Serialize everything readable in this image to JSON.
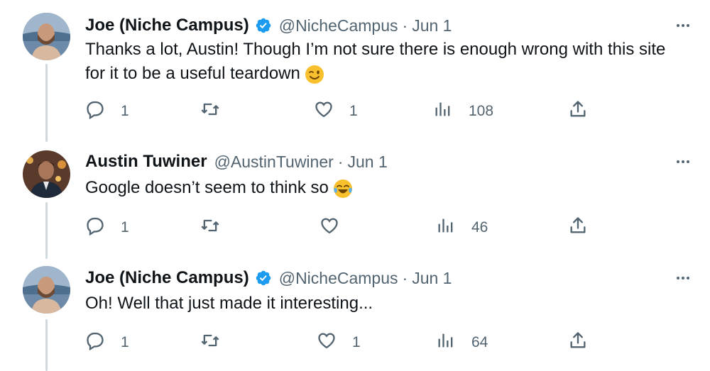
{
  "tweets": [
    {
      "name": "Joe (Niche Campus)",
      "verified": true,
      "handle": "@NicheCampus",
      "separator": "·",
      "date": "Jun 1",
      "text": "Thanks a lot, Austin! Though I’m not sure there is enough wrong with this site for it to be a useful teardown",
      "emoji": "winking-face",
      "replies": "1",
      "retweets": "",
      "likes": "1",
      "views": "108"
    },
    {
      "name": "Austin Tuwiner",
      "verified": false,
      "handle": "@AustinTuwiner",
      "separator": "·",
      "date": "Jun 1",
      "text": "Google doesn’t seem to think so",
      "emoji": "tears-of-joy",
      "replies": "1",
      "retweets": "",
      "likes": "",
      "views": "46"
    },
    {
      "name": "Joe (Niche Campus)",
      "verified": true,
      "handle": "@NicheCampus",
      "separator": "·",
      "date": "Jun 1",
      "text": "Oh! Well that just made it interesting...",
      "emoji": "",
      "replies": "1",
      "retweets": "",
      "likes": "1",
      "views": "64"
    }
  ],
  "colors": {
    "text": "#0f1419",
    "secondary": "#536471",
    "verified": "#1d9bf0",
    "thread_line": "#cfd9de"
  }
}
